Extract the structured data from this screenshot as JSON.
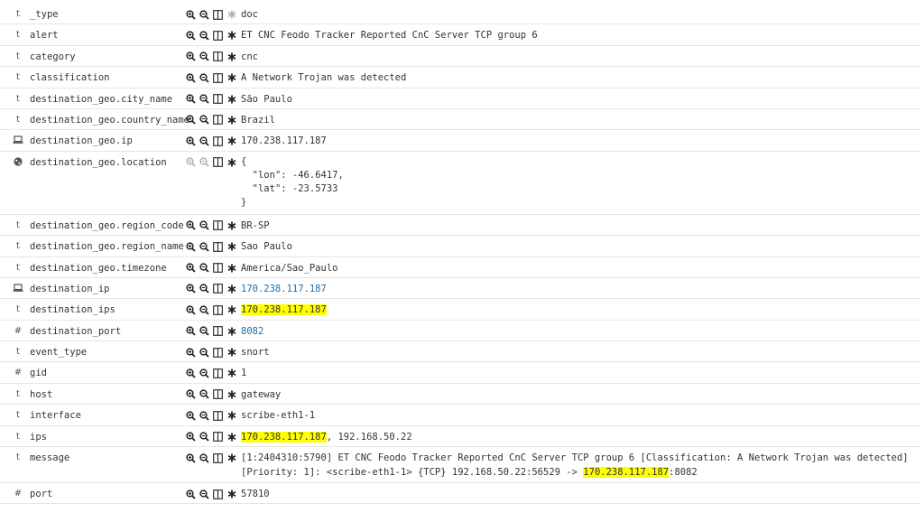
{
  "icons": {
    "zoom_in": "magnifier-plus-icon",
    "zoom_out": "magnifier-minus-icon",
    "toggle_column": "columns-icon",
    "exists": "asterisk-icon",
    "string_type": "t",
    "number_type": "#",
    "ip_type": "laptop-icon",
    "geo_type": "globe-icon"
  },
  "colors": {
    "highlight": "#ffff00",
    "link": "#1f6fa6",
    "text": "#333333",
    "border": "#e6e6e6"
  },
  "fields": {
    "f_type": {
      "type": "t",
      "name": "_type",
      "value": "doc"
    },
    "alert": {
      "type": "t",
      "name": "alert",
      "value": "ET CNC Feodo Tracker Reported CnC Server TCP group 6"
    },
    "category": {
      "type": "t",
      "name": "category",
      "value": "cnc"
    },
    "classification": {
      "type": "t",
      "name": "classification",
      "value": "A Network Trojan was detected"
    },
    "dg_city": {
      "type": "t",
      "name": "destination_geo.city_name",
      "value": "São Paulo"
    },
    "dg_country": {
      "type": "t",
      "name": "destination_geo.country_name",
      "value": "Brazil"
    },
    "dg_ip": {
      "type": "ip",
      "name": "destination_geo.ip",
      "value": "170.238.117.187"
    },
    "dg_location": {
      "type": "geo",
      "name": "destination_geo.location",
      "value": "{\n  \"lon\": -46.6417,\n  \"lat\": -23.5733\n}"
    },
    "dg_region_code": {
      "type": "t",
      "name": "destination_geo.region_code",
      "value": "BR-SP"
    },
    "dg_region_name": {
      "type": "t",
      "name": "destination_geo.region_name",
      "value": "Sao Paulo"
    },
    "dg_timezone": {
      "type": "t",
      "name": "destination_geo.timezone",
      "value": "America/Sao_Paulo"
    },
    "destination_ip": {
      "type": "ip",
      "name": "destination_ip",
      "value": "170.238.117.187"
    },
    "destination_ips": {
      "type": "t",
      "name": "destination_ips",
      "value": "170.238.117.187"
    },
    "destination_port": {
      "type": "#",
      "name": "destination_port",
      "value": "8082"
    },
    "event_type": {
      "type": "t",
      "name": "event_type",
      "value": "snort"
    },
    "gid": {
      "type": "#",
      "name": "gid",
      "value": "1"
    },
    "host": {
      "type": "t",
      "name": "host",
      "value": "gateway"
    },
    "interface": {
      "type": "t",
      "name": "interface",
      "value": "scribe-eth1-1"
    },
    "ips": {
      "type": "t",
      "name": "ips",
      "value_hl": "170.238.117.187",
      "value_rest": ", 192.168.50.22"
    },
    "message": {
      "type": "t",
      "name": "message",
      "value_pre": "[1:2404310:5790] ET CNC Feodo Tracker Reported CnC Server TCP group 6 [Classification: A Network Trojan was detected] [Priority: 1]: <scribe-eth1-1> {TCP} 192.168.50.22:56529 -> ",
      "value_hl": "170.238.117.187",
      "value_post": ":8082"
    },
    "port": {
      "type": "#",
      "name": "port",
      "value": "57810"
    }
  }
}
